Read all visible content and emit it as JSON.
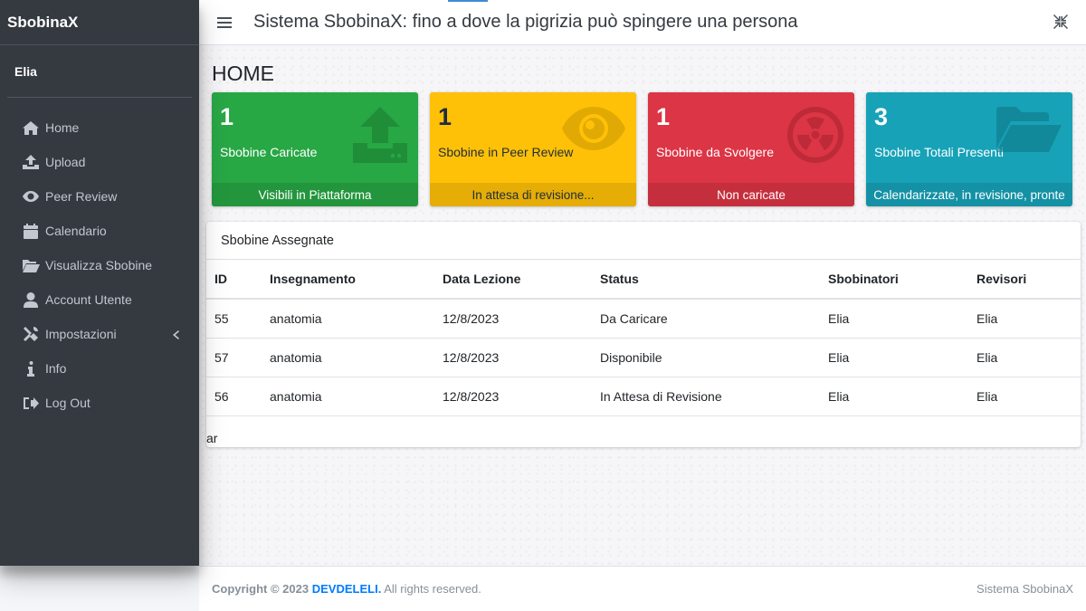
{
  "brand": "SbobinaX",
  "user": {
    "name": "Elia"
  },
  "sidebar": {
    "items": [
      {
        "label": "Home",
        "icon": "home-icon"
      },
      {
        "label": "Upload",
        "icon": "upload-icon"
      },
      {
        "label": "Peer Review",
        "icon": "eye-icon"
      },
      {
        "label": "Calendario",
        "icon": "calendar-icon"
      },
      {
        "label": "Visualizza Sbobine",
        "icon": "folder-open-icon"
      },
      {
        "label": "Account Utente",
        "icon": "user-icon"
      },
      {
        "label": "Impostazioni",
        "icon": "tools-icon"
      },
      {
        "label": "Info",
        "icon": "info-icon"
      },
      {
        "label": "Log Out",
        "icon": "sign-out-icon"
      }
    ]
  },
  "navbar": {
    "title": "Sistema SbobinaX: fino a dove la pigrizia può spingere una persona"
  },
  "page": {
    "title": "HOME"
  },
  "boxes": [
    {
      "count": "1",
      "label": "Sbobine Caricate",
      "footer": "Visibili in Piattaforma",
      "color": "#28a745",
      "icon": "upload-icon"
    },
    {
      "count": "1",
      "label": "Sbobine in Peer Review",
      "footer": "In attesa di revisione...",
      "color": "#ffc107",
      "icon": "eye-icon"
    },
    {
      "count": "1",
      "label": "Sbobine da Svolgere",
      "footer": "Non caricate",
      "color": "#dc3545",
      "icon": "radiation-icon"
    },
    {
      "count": "3",
      "label": "Sbobine Totali Presenti",
      "footer": "Calendarizzate, in revisione, pronte",
      "color": "#17a2b8",
      "icon": "folder-open-icon"
    }
  ],
  "assigned": {
    "title": "Sbobine Assegnate",
    "columns": [
      "ID",
      "Insegnamento",
      "Data Lezione",
      "Status",
      "Sbobinatori",
      "Revisori"
    ],
    "rows": [
      [
        "55",
        "anatomia",
        "12/8/2023",
        "Da Caricare",
        "Elia",
        "Elia"
      ],
      [
        "57",
        "anatomia",
        "12/8/2023",
        "Disponibile",
        "Elia",
        "Elia"
      ],
      [
        "56",
        "anatomia",
        "12/8/2023",
        "In Attesa di Revisione",
        "Elia",
        "Elia"
      ]
    ],
    "footnote": "ar"
  },
  "footer": {
    "copyright": "Copyright © 2023",
    "company": "DEVDELELI.",
    "rights": "All rights reserved.",
    "right_text": "Sistema SbobinaX"
  }
}
